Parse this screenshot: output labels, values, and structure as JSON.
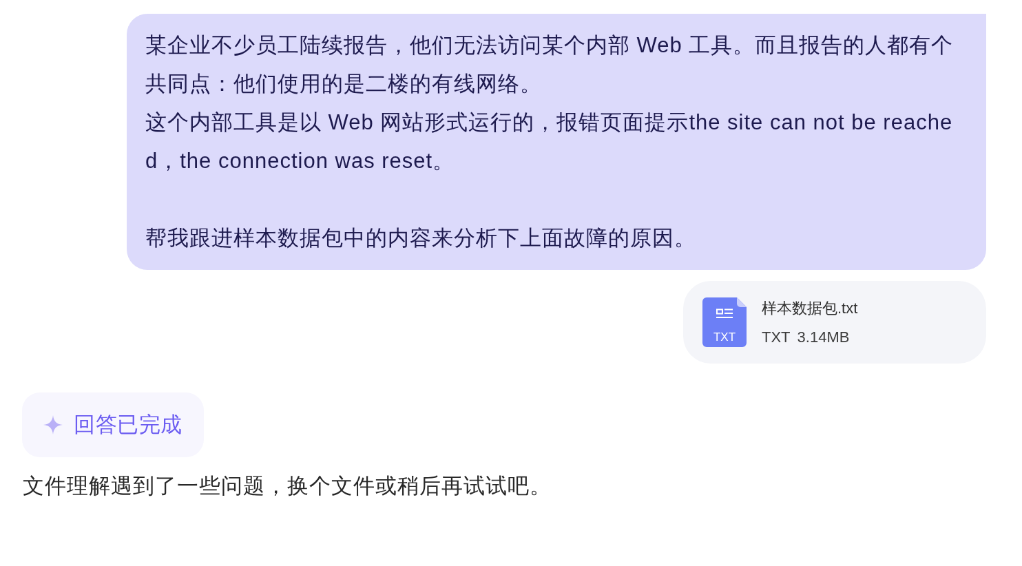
{
  "user_message": {
    "sections": [
      {
        "paragraphs": [
          "某企业不少员工陆续报告，他们无法访问某个内部 Web 工具。而且报告的人都有个共同点：他们使用的是二楼的有线网络。",
          "这个内部工具是以 Web 网站形式运行的，报错页面提示the site can not be reached，the connection was reset。"
        ]
      },
      {
        "paragraphs": [
          "帮我跟进样本数据包中的内容来分析下上面故障的原因。"
        ]
      }
    ]
  },
  "attachment": {
    "icon_label": "TXT",
    "name": "样本数据包.txt",
    "type": "TXT",
    "size": "3.14MB"
  },
  "status": {
    "label": "回答已完成"
  },
  "reply": {
    "text": "文件理解遇到了一些问题，换个文件或稍后再试试吧。"
  }
}
